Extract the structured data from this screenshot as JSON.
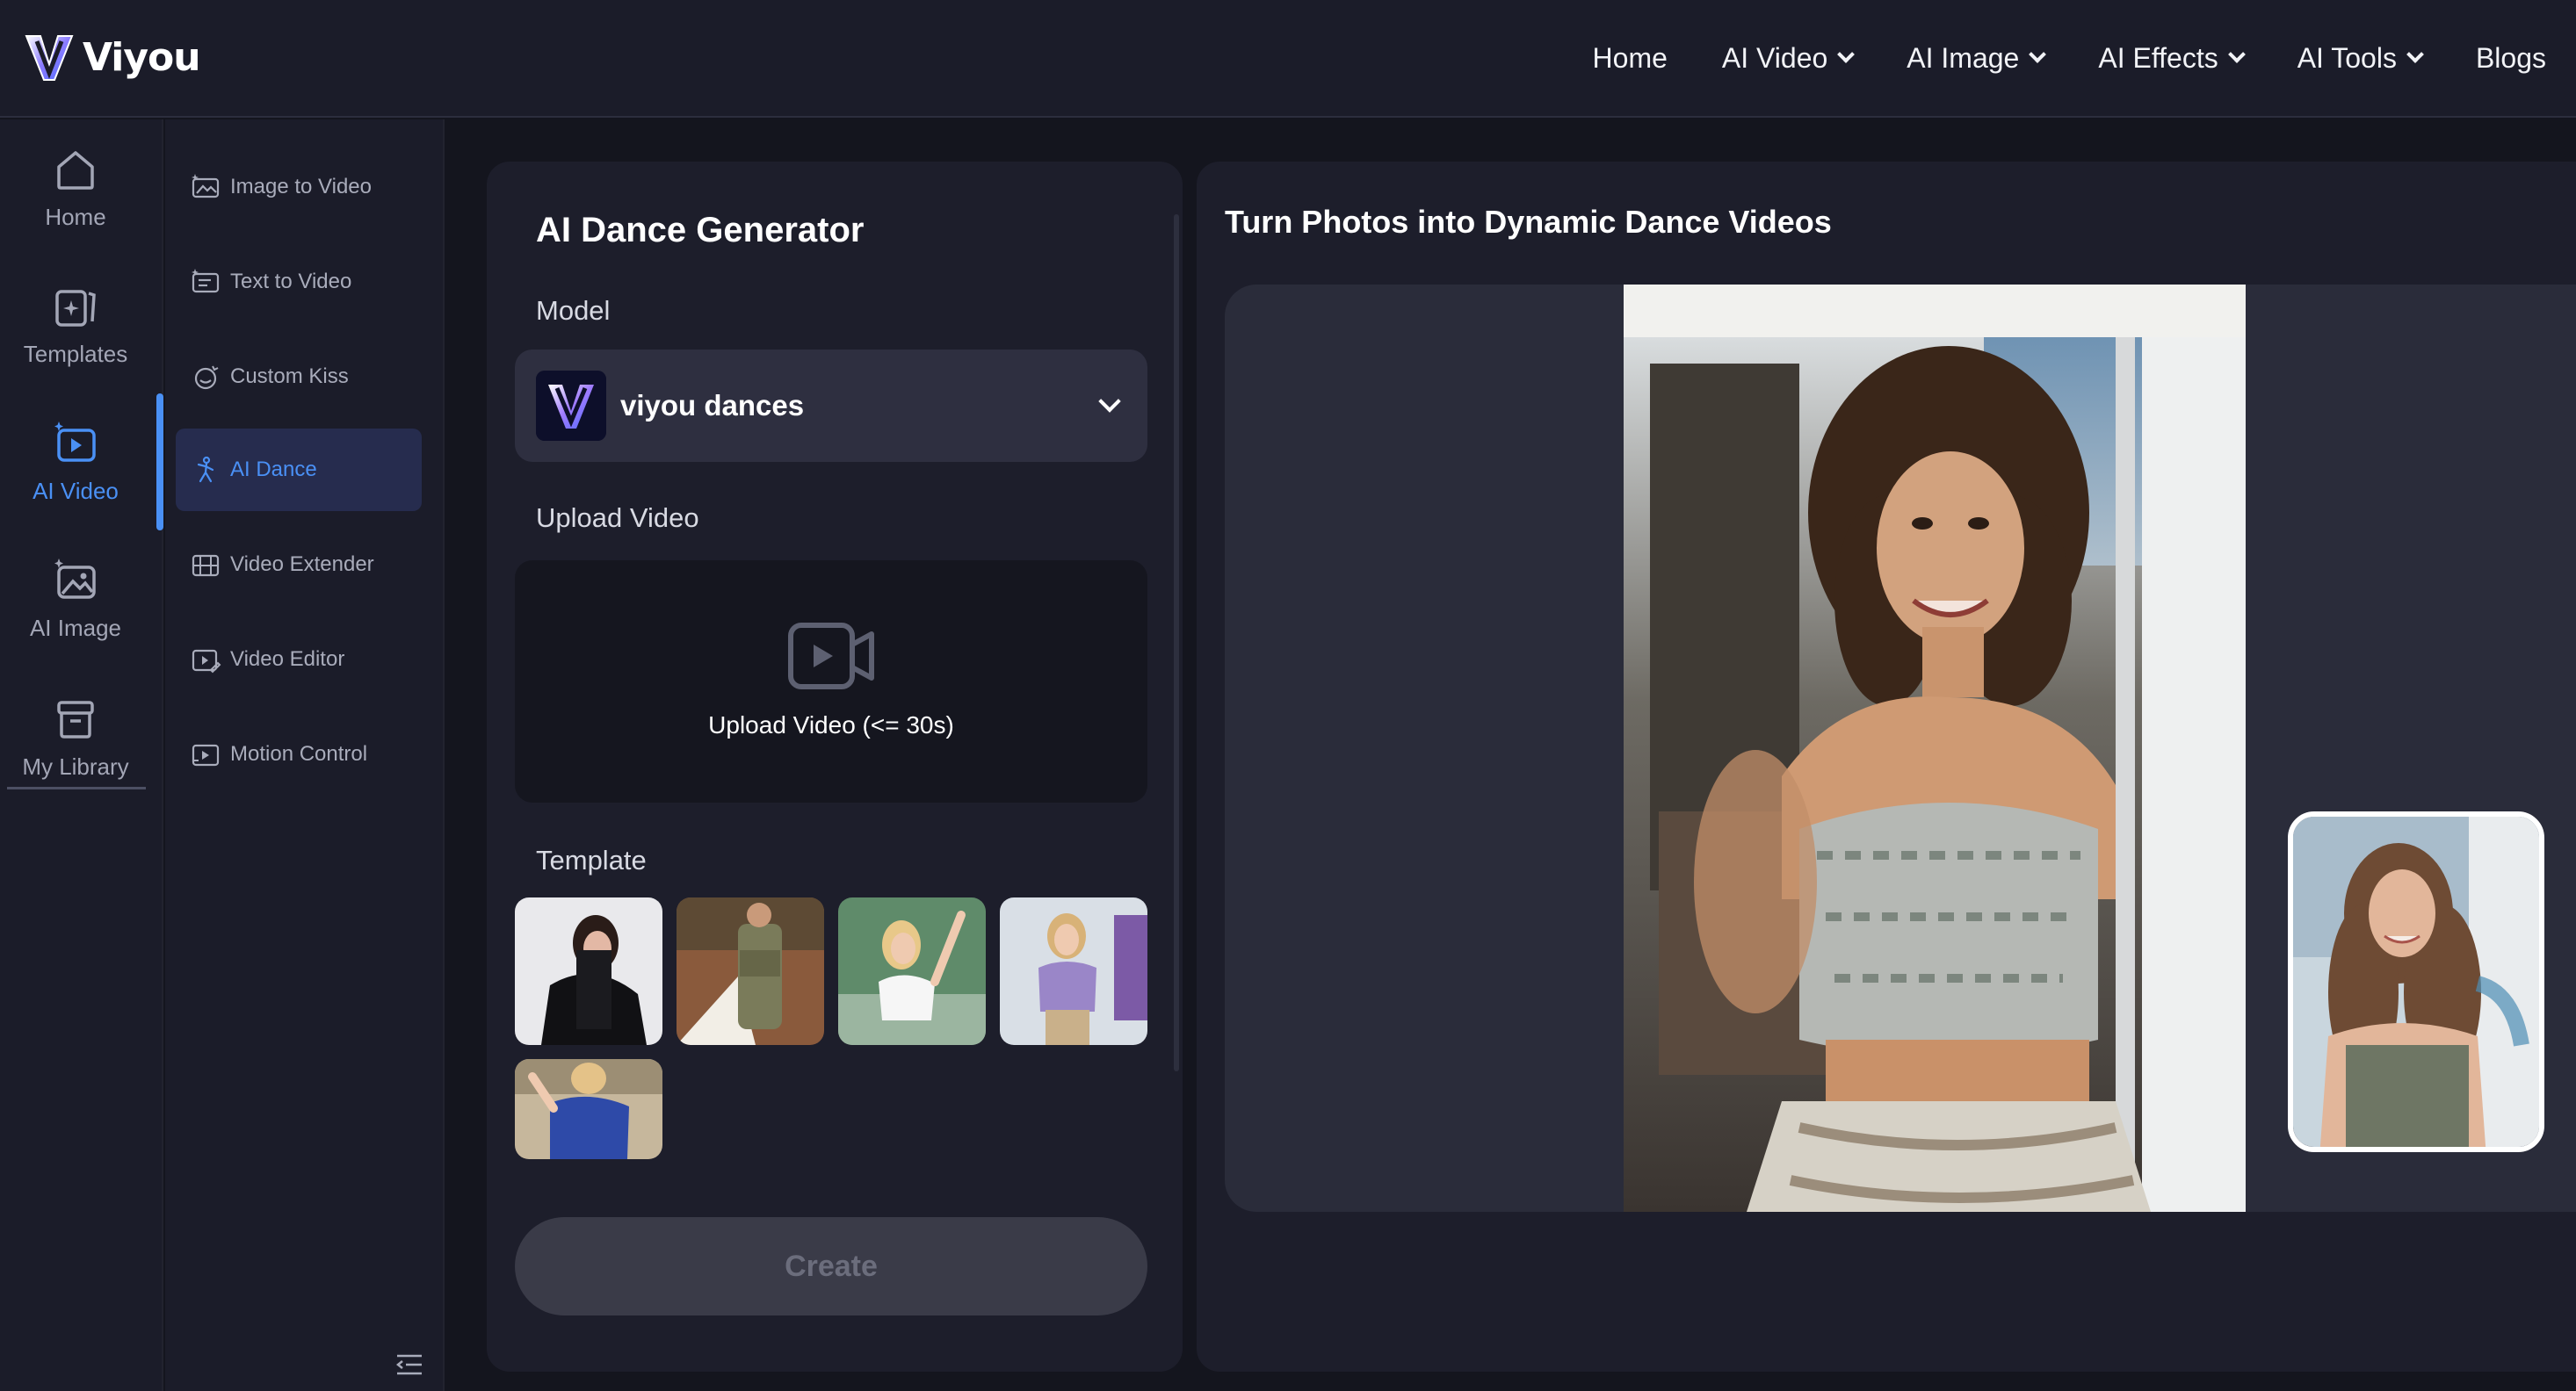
{
  "header": {
    "brand": "Viyou",
    "nav": [
      {
        "label": "Home",
        "dropdown": false
      },
      {
        "label": "AI Video",
        "dropdown": true
      },
      {
        "label": "AI Image",
        "dropdown": true
      },
      {
        "label": "AI Effects",
        "dropdown": true
      },
      {
        "label": "AI Tools",
        "dropdown": true
      },
      {
        "label": "Blogs",
        "dropdown": false
      }
    ]
  },
  "rail": {
    "items": [
      {
        "label": "Home",
        "icon": "home-icon",
        "active": false
      },
      {
        "label": "Templates",
        "icon": "templates-icon",
        "active": false
      },
      {
        "label": "AI Video",
        "icon": "ai-video-icon",
        "active": true
      },
      {
        "label": "AI Image",
        "icon": "ai-image-icon",
        "active": false
      },
      {
        "label": "My Library",
        "icon": "library-icon",
        "active": false
      }
    ]
  },
  "submenu": {
    "items": [
      {
        "label": "Image to Video",
        "icon": "image-to-video-icon",
        "active": false
      },
      {
        "label": "Text to Video",
        "icon": "text-to-video-icon",
        "active": false
      },
      {
        "label": "Custom Kiss",
        "icon": "kiss-icon",
        "active": false
      },
      {
        "label": "AI Dance",
        "icon": "dance-icon",
        "active": true
      },
      {
        "label": "Video Extender",
        "icon": "video-extender-icon",
        "active": false
      },
      {
        "label": "Video Editor",
        "icon": "video-editor-icon",
        "active": false
      },
      {
        "label": "Motion Control",
        "icon": "motion-control-icon",
        "active": false
      }
    ],
    "collapse_icon": "collapse-menu-icon"
  },
  "panel": {
    "title": "AI Dance Generator",
    "model_label": "Model",
    "model_value": "viyou dances",
    "upload_label": "Upload Video",
    "upload_text": "Upload Video (<= 30s)",
    "template_label": "Template",
    "templates": [
      "template-1",
      "template-2",
      "template-3",
      "template-4",
      "template-5"
    ],
    "create_label": "Create"
  },
  "preview": {
    "title": "Turn Photos into Dynamic Dance Videos"
  },
  "colors": {
    "accent": "#4a90f5",
    "background": "#14151e",
    "panel": "#1d1e2b",
    "active_bg": "#262c4e"
  }
}
